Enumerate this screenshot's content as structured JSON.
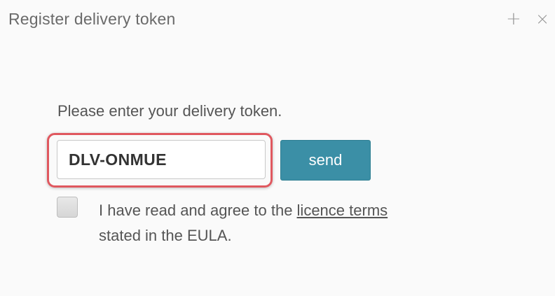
{
  "header": {
    "title": "Register delivery token",
    "plus_label": "+",
    "close_label": "×"
  },
  "form": {
    "prompt": "Please enter your delivery token.",
    "token_value": "DLV-ONMUE",
    "send_label": "send",
    "highlight_color": "#e0585f",
    "button_color": "#3b8fa6"
  },
  "agreement": {
    "checked": false,
    "text_before": "I have read and agree to the ",
    "link_text": "licence terms",
    "text_after": "stated in the EULA."
  }
}
